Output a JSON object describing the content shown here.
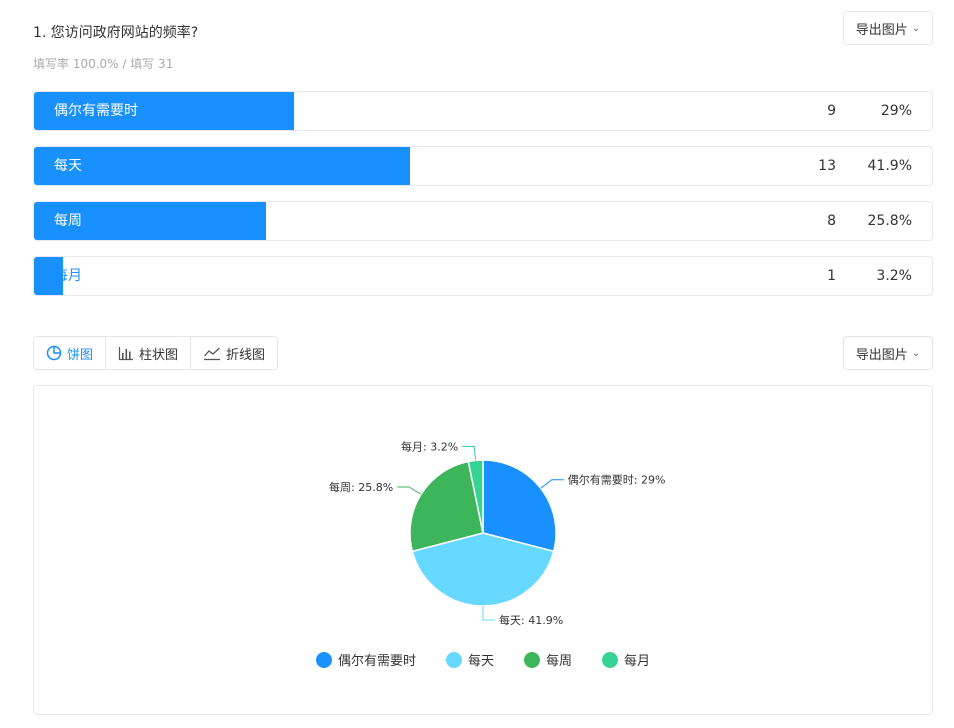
{
  "question": {
    "title": "1. 您访问政府网站的频率?",
    "meta": "填写率 100.0% / 填写 31"
  },
  "export_label": "导出图片",
  "rows": [
    {
      "label": "偶尔有需要时",
      "count": "9",
      "percent": "29%",
      "fraction": 0.29
    },
    {
      "label": "每天",
      "count": "13",
      "percent": "41.9%",
      "fraction": 0.419
    },
    {
      "label": "每周",
      "count": "8",
      "percent": "25.8%",
      "fraction": 0.258
    },
    {
      "label": "每月",
      "count": "1",
      "percent": "3.2%",
      "fraction": 0.032
    }
  ],
  "tabs": [
    {
      "label": "饼图",
      "icon": "pie-chart-icon",
      "active": true
    },
    {
      "label": "柱状图",
      "icon": "bar-chart-icon",
      "active": false
    },
    {
      "label": "折线图",
      "icon": "line-chart-icon",
      "active": false
    }
  ],
  "chart_data": {
    "type": "pie",
    "categories": [
      "偶尔有需要时",
      "每天",
      "每周",
      "每月"
    ],
    "values": [
      9,
      13,
      8,
      1
    ],
    "percent_labels": [
      "偶尔有需要时: 29%",
      "每天: 41.9%",
      "每周: 25.8%",
      "每月: 3.2%"
    ],
    "colors": [
      "#1890ff",
      "#67d8ff",
      "#3cb55b",
      "#35d496"
    ],
    "legend_position": "bottom",
    "start_angle_deg": 90,
    "direction": "clockwise"
  }
}
